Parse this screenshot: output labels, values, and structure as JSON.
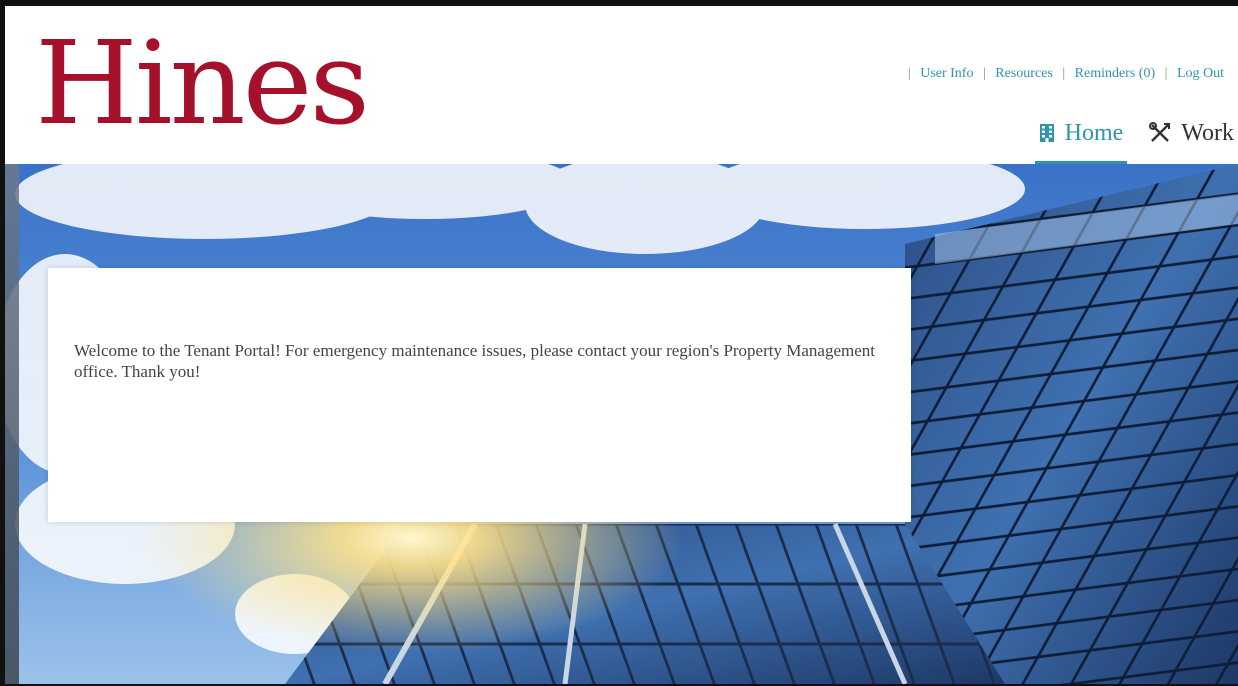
{
  "brand": {
    "logo_text": "Hines",
    "logo_color": "#a5112a",
    "accent_color": "#2f95a9"
  },
  "util_nav": {
    "items": [
      {
        "label": "User Info"
      },
      {
        "label": "Resources"
      },
      {
        "label": "Reminders (0)"
      },
      {
        "label": "Log Out"
      }
    ]
  },
  "main_nav": {
    "tabs": [
      {
        "label": "Home",
        "icon": "building-icon",
        "active": true
      },
      {
        "label": "Work",
        "icon": "tools-icon",
        "active": false
      }
    ]
  },
  "welcome": {
    "message": "Welcome to the Tenant Portal! For emergency maintenance issues, please contact your region's Property Management office. Thank you!"
  }
}
